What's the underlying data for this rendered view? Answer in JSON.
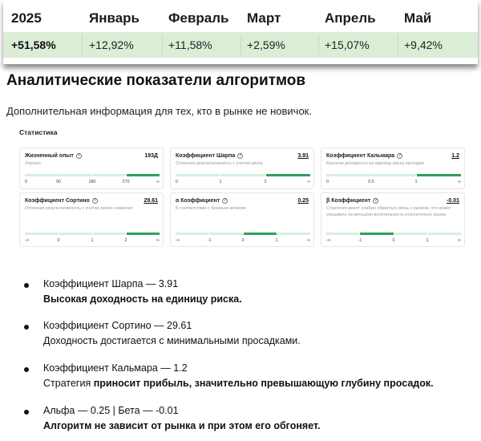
{
  "returns_table": {
    "headers": [
      "2025",
      "Январь",
      "Февраль",
      "Март",
      "Апрель",
      "Май"
    ],
    "values": [
      "+51,58%",
      "+12,92%",
      "+11,58%",
      "+2,59%",
      "+15,07%",
      "+9,42%"
    ],
    "row_bg": "#dcedd6"
  },
  "section": {
    "title": "Аналитические показатели алгоритмов",
    "subtitle": "Дополнительная информация для тех, кто в рынке не новичок."
  },
  "stats": {
    "label": "Статистика",
    "accent": "#2ea05a",
    "cards": [
      {
        "title": "Жизненный опыт",
        "value": "193Д",
        "underline": false,
        "desc": "Хорошо",
        "ticks": [
          "0",
          "90",
          "180",
          "270",
          "∞"
        ],
        "active_segment": 3
      },
      {
        "title": "Коэффициент Шарпа",
        "value": "3.91",
        "underline": true,
        "desc": "Отличная результативность с учетом риска",
        "ticks": [
          "0",
          "1",
          "2",
          "∞"
        ],
        "active_segment": 2
      },
      {
        "title": "Коэффициент Кальмара",
        "value": "1.2",
        "underline": true,
        "desc": "Высокая доходность на единицу риска просадки",
        "ticks": [
          "0",
          "0.5",
          "1",
          "∞"
        ],
        "active_segment": 2
      },
      {
        "title": "Коэффициент Сортино",
        "value": "29.61",
        "underline": true,
        "desc": "Отличная результативность с учетом риска снижения",
        "ticks": [
          "-∞",
          "0",
          "1",
          "2",
          "∞"
        ],
        "active_segment": 3
      },
      {
        "title": "α Коэффициент",
        "value": "0.25",
        "underline": true,
        "desc": "В соответствии с базовым активом",
        "ticks": [
          "-∞",
          "-1",
          "0",
          "1",
          "∞"
        ],
        "active_segment": 2
      },
      {
        "title": "β Коэффициент",
        "value": "-0.01",
        "underline": true,
        "desc": "Стратегия имеет слабую обратную связь с рынком, что может указывать на меньшую волатильность относительно рынка.",
        "ticks": [
          "-∞",
          "-1",
          "0",
          "1",
          "∞"
        ],
        "active_segment": 1
      }
    ]
  },
  "bullets": [
    {
      "main": "Коэффициент Шарпа — 3.91",
      "desc_bold": "Высокая доходность на единицу риска.",
      "desc_pre": "",
      "desc_post": ""
    },
    {
      "main": "Коэффициент Сортино — 29.61",
      "desc_bold": "",
      "desc_pre": "Доходность достигается с минимальными просадками.",
      "desc_post": ""
    },
    {
      "main": "Коэффициент Кальмара — 1.2",
      "desc_bold": "приносит прибыль, значительно превышающую глубину просадок.",
      "desc_pre": "Стратегия ",
      "desc_post": ""
    },
    {
      "main": "Альфа — 0.25 | Бета — -0.01",
      "desc_bold": "Алгоритм не зависит от рынка и при этом его обгоняет.",
      "desc_pre": "",
      "desc_post": ""
    }
  ]
}
